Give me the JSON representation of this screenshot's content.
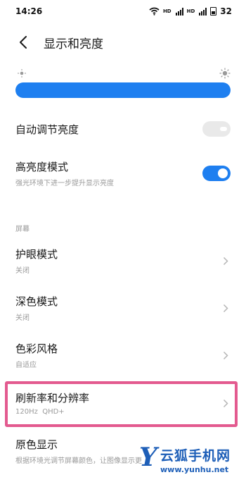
{
  "status_bar": {
    "time": "14:26",
    "sim_label_1": "HD",
    "sim_label_2": "HD",
    "battery": "32"
  },
  "header": {
    "title": "显示和亮度"
  },
  "brightness": {
    "level": 1.0,
    "color": "#1e7ff0"
  },
  "settings": {
    "auto_brightness": {
      "title": "自动调节亮度",
      "enabled": false
    },
    "high_brightness": {
      "title": "高亮度模式",
      "subtitle": "强光环境下进一步提升显示亮度",
      "enabled": true
    },
    "section_screen": "屏幕",
    "eye_care": {
      "title": "护眼模式",
      "subtitle": "关闭"
    },
    "dark_mode": {
      "title": "深色模式",
      "subtitle": "关闭"
    },
    "color_style": {
      "title": "色彩风格",
      "subtitle": "自适应"
    },
    "refresh_resolution": {
      "title": "刷新率和分辨率",
      "subtitle": "120Hz  QHD+"
    },
    "true_tone": {
      "title": "原色显示",
      "subtitle": "根据环境光调节屏幕颜色，让图像显示更"
    }
  },
  "watermark": {
    "letter": "Y",
    "name": "云狐手机网",
    "url": "www.yunhu.net"
  },
  "colors": {
    "accent": "#1e7ff0",
    "highlight": "#e35a8f",
    "watermark": "#1e5fb8"
  },
  "icons": [
    "wifi-icon",
    "signal-icon",
    "battery-icon",
    "back-icon",
    "sun-small-icon",
    "sun-large-icon",
    "chevron-right-icon"
  ]
}
